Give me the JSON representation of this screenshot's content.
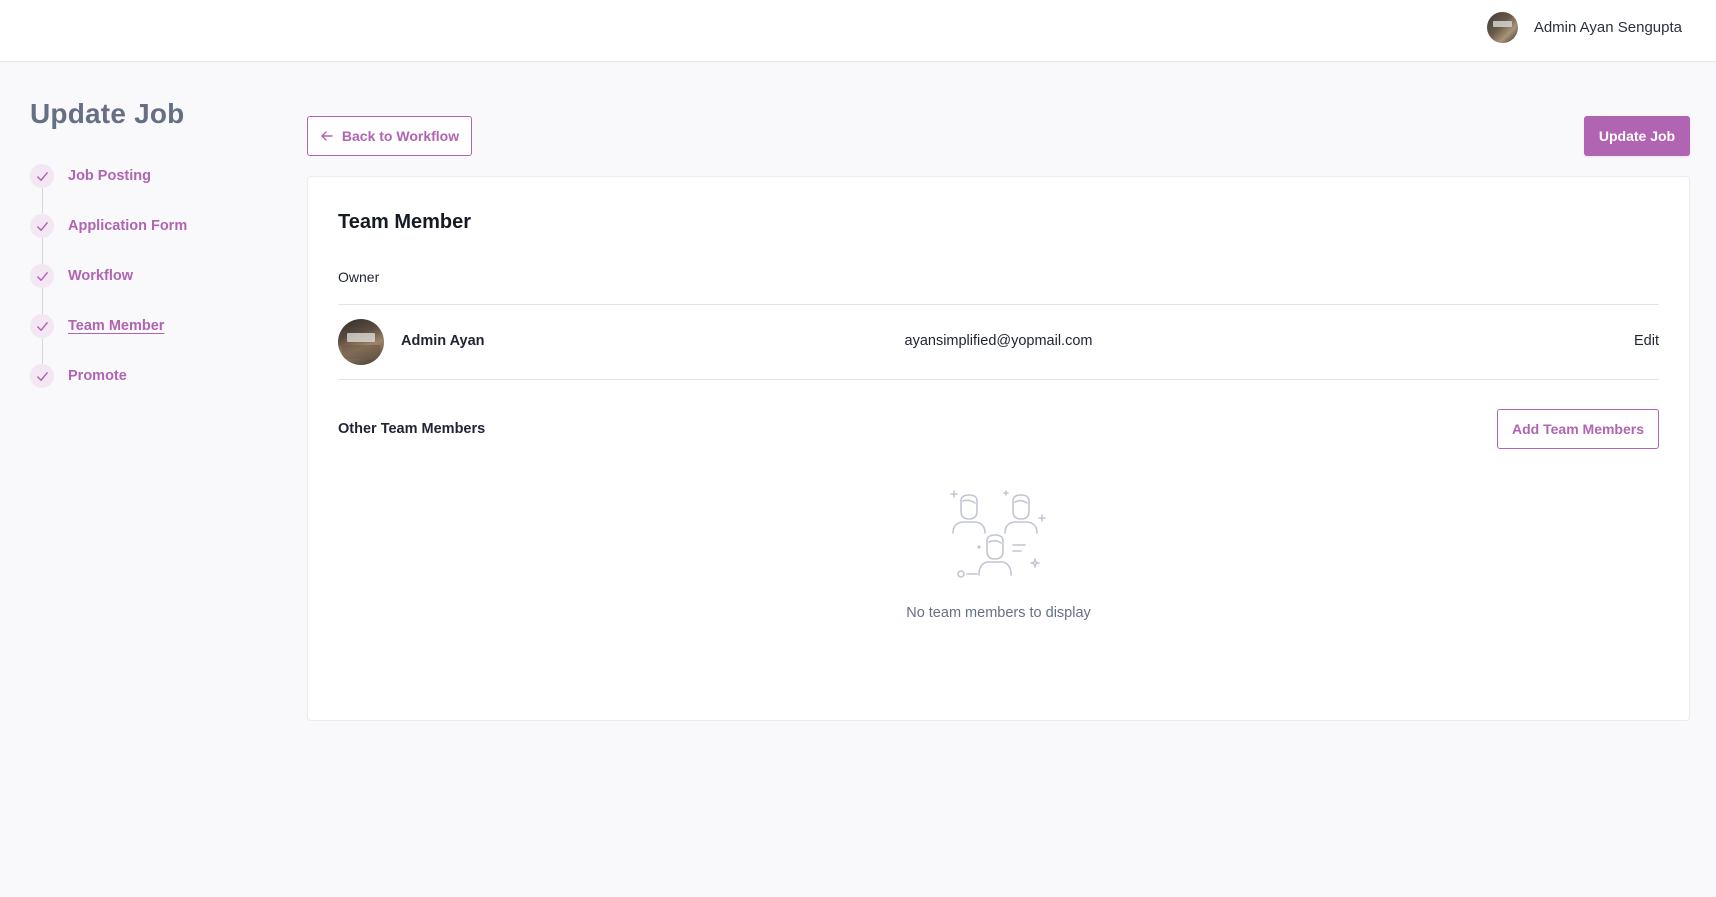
{
  "header": {
    "user_name": "Admin Ayan Sengupta"
  },
  "sidebar": {
    "title": "Update Job",
    "steps": [
      {
        "label": "Job Posting"
      },
      {
        "label": "Application Form"
      },
      {
        "label": "Workflow"
      },
      {
        "label": "Team Member",
        "active": true
      },
      {
        "label": "Promote"
      }
    ]
  },
  "toolbar": {
    "back_label": "Back to Workflow",
    "update_label": "Update Job"
  },
  "card": {
    "title": "Team Member",
    "owner_label": "Owner",
    "owner": {
      "name": "Admin Ayan",
      "email": "ayansimplified@yopmail.com",
      "edit_label": "Edit"
    },
    "other_label": "Other Team Members",
    "add_label": "Add Team Members",
    "empty_text": "No team members to display"
  },
  "colors": {
    "accent": "#b064b2",
    "muted": "#667085"
  }
}
